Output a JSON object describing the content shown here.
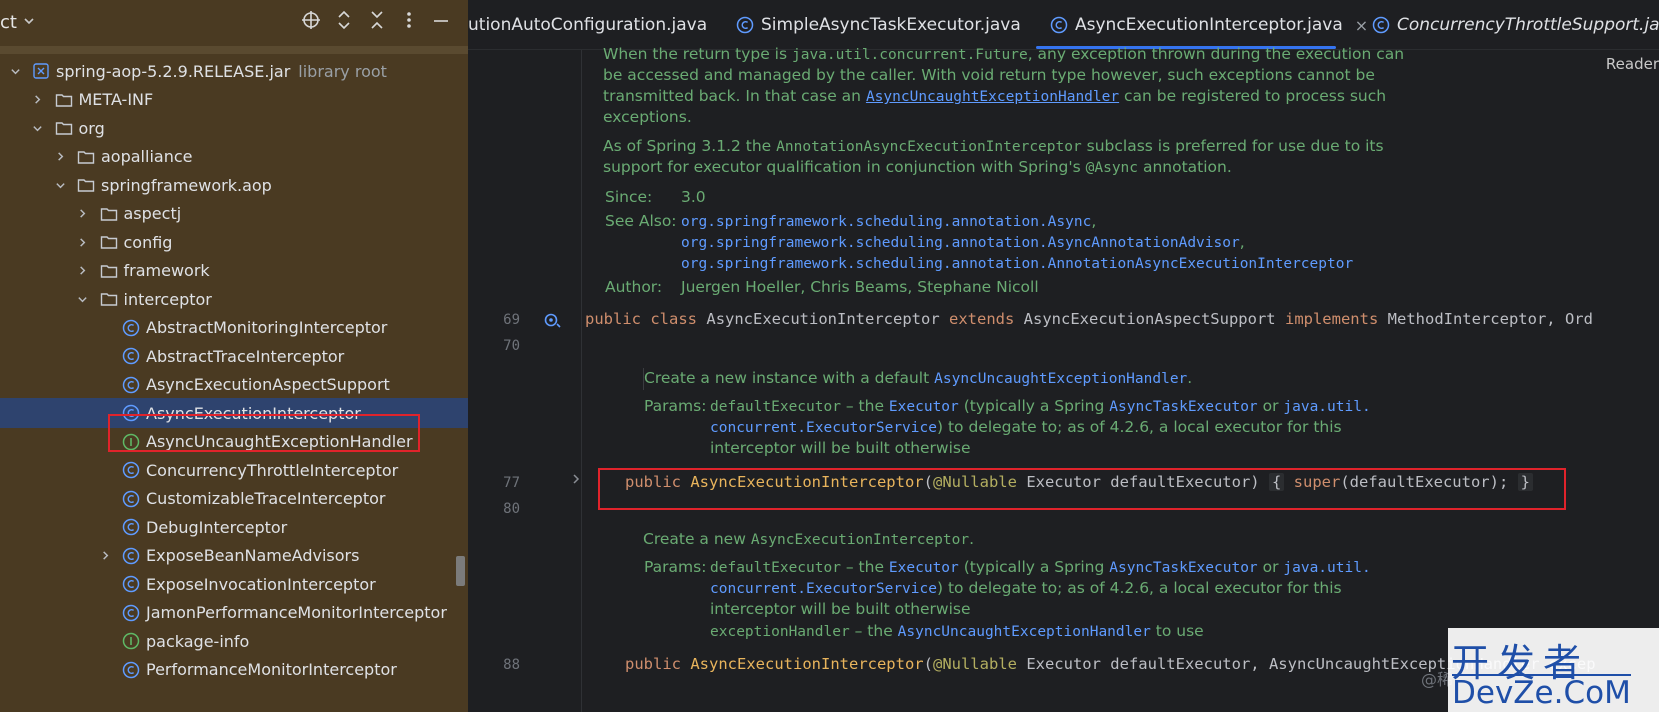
{
  "project": {
    "title": "ct",
    "tree": [
      {
        "label": "spring-aop-5.2.9.RELEASE.jar",
        "suffix": "library root",
        "kind": "jar",
        "expanded": true
      },
      {
        "label": "META-INF",
        "kind": "folder",
        "expanded": false
      },
      {
        "label": "org",
        "kind": "folder",
        "expanded": true
      },
      {
        "label": "aopalliance",
        "kind": "folder",
        "expanded": false
      },
      {
        "label": "springframework.aop",
        "kind": "folder",
        "expanded": true
      },
      {
        "label": "aspectj",
        "kind": "folder",
        "expanded": false
      },
      {
        "label": "config",
        "kind": "folder",
        "expanded": false
      },
      {
        "label": "framework",
        "kind": "folder",
        "expanded": false
      },
      {
        "label": "interceptor",
        "kind": "folder",
        "expanded": true
      },
      {
        "label": "AbstractMonitoringInterceptor",
        "kind": "class"
      },
      {
        "label": "AbstractTraceInterceptor",
        "kind": "class"
      },
      {
        "label": "AsyncExecutionAspectSupport",
        "kind": "class"
      },
      {
        "label": "AsyncExecutionInterceptor",
        "kind": "class",
        "selected": true
      },
      {
        "label": "AsyncUncaughtExceptionHandler",
        "kind": "interface"
      },
      {
        "label": "ConcurrencyThrottleInterceptor",
        "kind": "class"
      },
      {
        "label": "CustomizableTraceInterceptor",
        "kind": "class"
      },
      {
        "label": "DebugInterceptor",
        "kind": "class"
      },
      {
        "label": "ExposeBeanNameAdvisors",
        "kind": "class",
        "expandable": true
      },
      {
        "label": "ExposeInvocationInterceptor",
        "kind": "class"
      },
      {
        "label": "JamonPerformanceMonitorInterceptor",
        "kind": "class"
      },
      {
        "label": "package-info",
        "kind": "interface"
      },
      {
        "label": "PerformanceMonitorInterceptor",
        "kind": "class"
      }
    ]
  },
  "tabs": [
    {
      "label": "utionAutoConfiguration.java"
    },
    {
      "label": "SimpleAsyncTaskExecutor.java"
    },
    {
      "label": "AsyncExecutionInterceptor.java",
      "active": true,
      "close": "×"
    },
    {
      "label": "ConcurrencyThrottleSupport.java",
      "italic": true
    }
  ],
  "editor": {
    "reader_label": "Reader",
    "doc1": {
      "l1a": "When the return type is ",
      "l1b": "java.util.concurrent.Future",
      "l1c": ", any exception thrown during the execution can",
      "l2": "be accessed and managed by the caller. With void return type however, such exceptions cannot be",
      "l3a": "transmitted back. In that case an ",
      "l3b": "AsyncUncaughtExceptionHandler",
      "l3c": " can be registered to process such",
      "l4": "exceptions.",
      "l5a": "As of Spring 3.1.2 the ",
      "l5b": "AnnotationAsyncExecutionInterceptor",
      "l5c": " subclass is preferred for use due to its",
      "l6a": "support for executor qualification in conjunction with Spring's ",
      "l6b": "@Async",
      "l6c": " annotation.",
      "since_label": "Since:",
      "since_value": "3.0",
      "see_label": "See Also:",
      "see1": "org.springframework.scheduling.annotation.Async",
      "see2": "org.springframework.scheduling.annotation.AsyncAnnotationAdvisor",
      "see3": "org.springframework.scheduling.annotation.AnnotationAsyncExecutionInterceptor",
      "author_label": "Author:",
      "author_value": "Juergen Hoeller, Chris Beams, Stephane Nicoll"
    },
    "line69": {
      "no": "69",
      "kw1": "public",
      "kw2": "class",
      "name": "AsyncExecutionInterceptor",
      "kw3": "extends",
      "sup": "AsyncExecutionAspectSupport",
      "kw4": "implements",
      "ifc": "MethodInterceptor, Ord"
    },
    "line70": "70",
    "doc2": {
      "l1a": "Create a new instance with a default ",
      "l1b": "AsyncUncaughtExceptionHandler",
      "l1c": ".",
      "params_label": "Params:",
      "p1a": "defaultExecutor",
      "p1b": " – the ",
      "p1c": "Executor",
      "p1d": " (typically a Spring ",
      "p1e": "AsyncTaskExecutor",
      "p1f": " or ",
      "p1g": "java.util.",
      "p2a": "concurrent.ExecutorService",
      "p2b": ") to delegate to; as of 4.2.6, a local executor for this",
      "p3": "interceptor will be built otherwise"
    },
    "line77": {
      "no": "77",
      "kw1": "public",
      "name": "AsyncExecutionInterceptor",
      "open": "(",
      "ann": "@Nullable",
      "params": " Executor defaultExecutor)",
      "lb": "{",
      "kw2": "super",
      "call": "(defaultExecutor);",
      "rb": "}"
    },
    "line80": "80",
    "doc3": {
      "l1a": "Create a new ",
      "l1b": "AsyncExecutionInterceptor",
      "l1c": ".",
      "params_label": "Params:",
      "p1a": "defaultExecutor",
      "p1b": " – the ",
      "p1c": "Executor",
      "p1d": " (typically a Spring ",
      "p1e": "AsyncTaskExecutor",
      "p1f": " or ",
      "p1g": "java.util.",
      "p2a": "concurrent.ExecutorService",
      "p2b": ") to delegate to; as of 4.2.6, a local executor for this",
      "p3": "interceptor will be built otherwise",
      "p4a": "exceptionHandler",
      "p4b": " – the ",
      "p4c": "AsyncUncaughtExceptionHandler",
      "p4d": " to use"
    },
    "line88": {
      "no": "88",
      "kw1": "public",
      "name": "AsyncExecutionInterceptor",
      "open": "(",
      "ann": "@Nullable",
      "params": " Executor defaultExecutor, AsyncUncaughtExceptionHandler excep"
    }
  },
  "watermark": {
    "top": "开发者",
    "bottom": "DevZe.CoM",
    "at": "@稀"
  },
  "colors": {
    "accent": "#3574f0",
    "highlight": "#e0232b",
    "panel": "#4a3a22"
  }
}
